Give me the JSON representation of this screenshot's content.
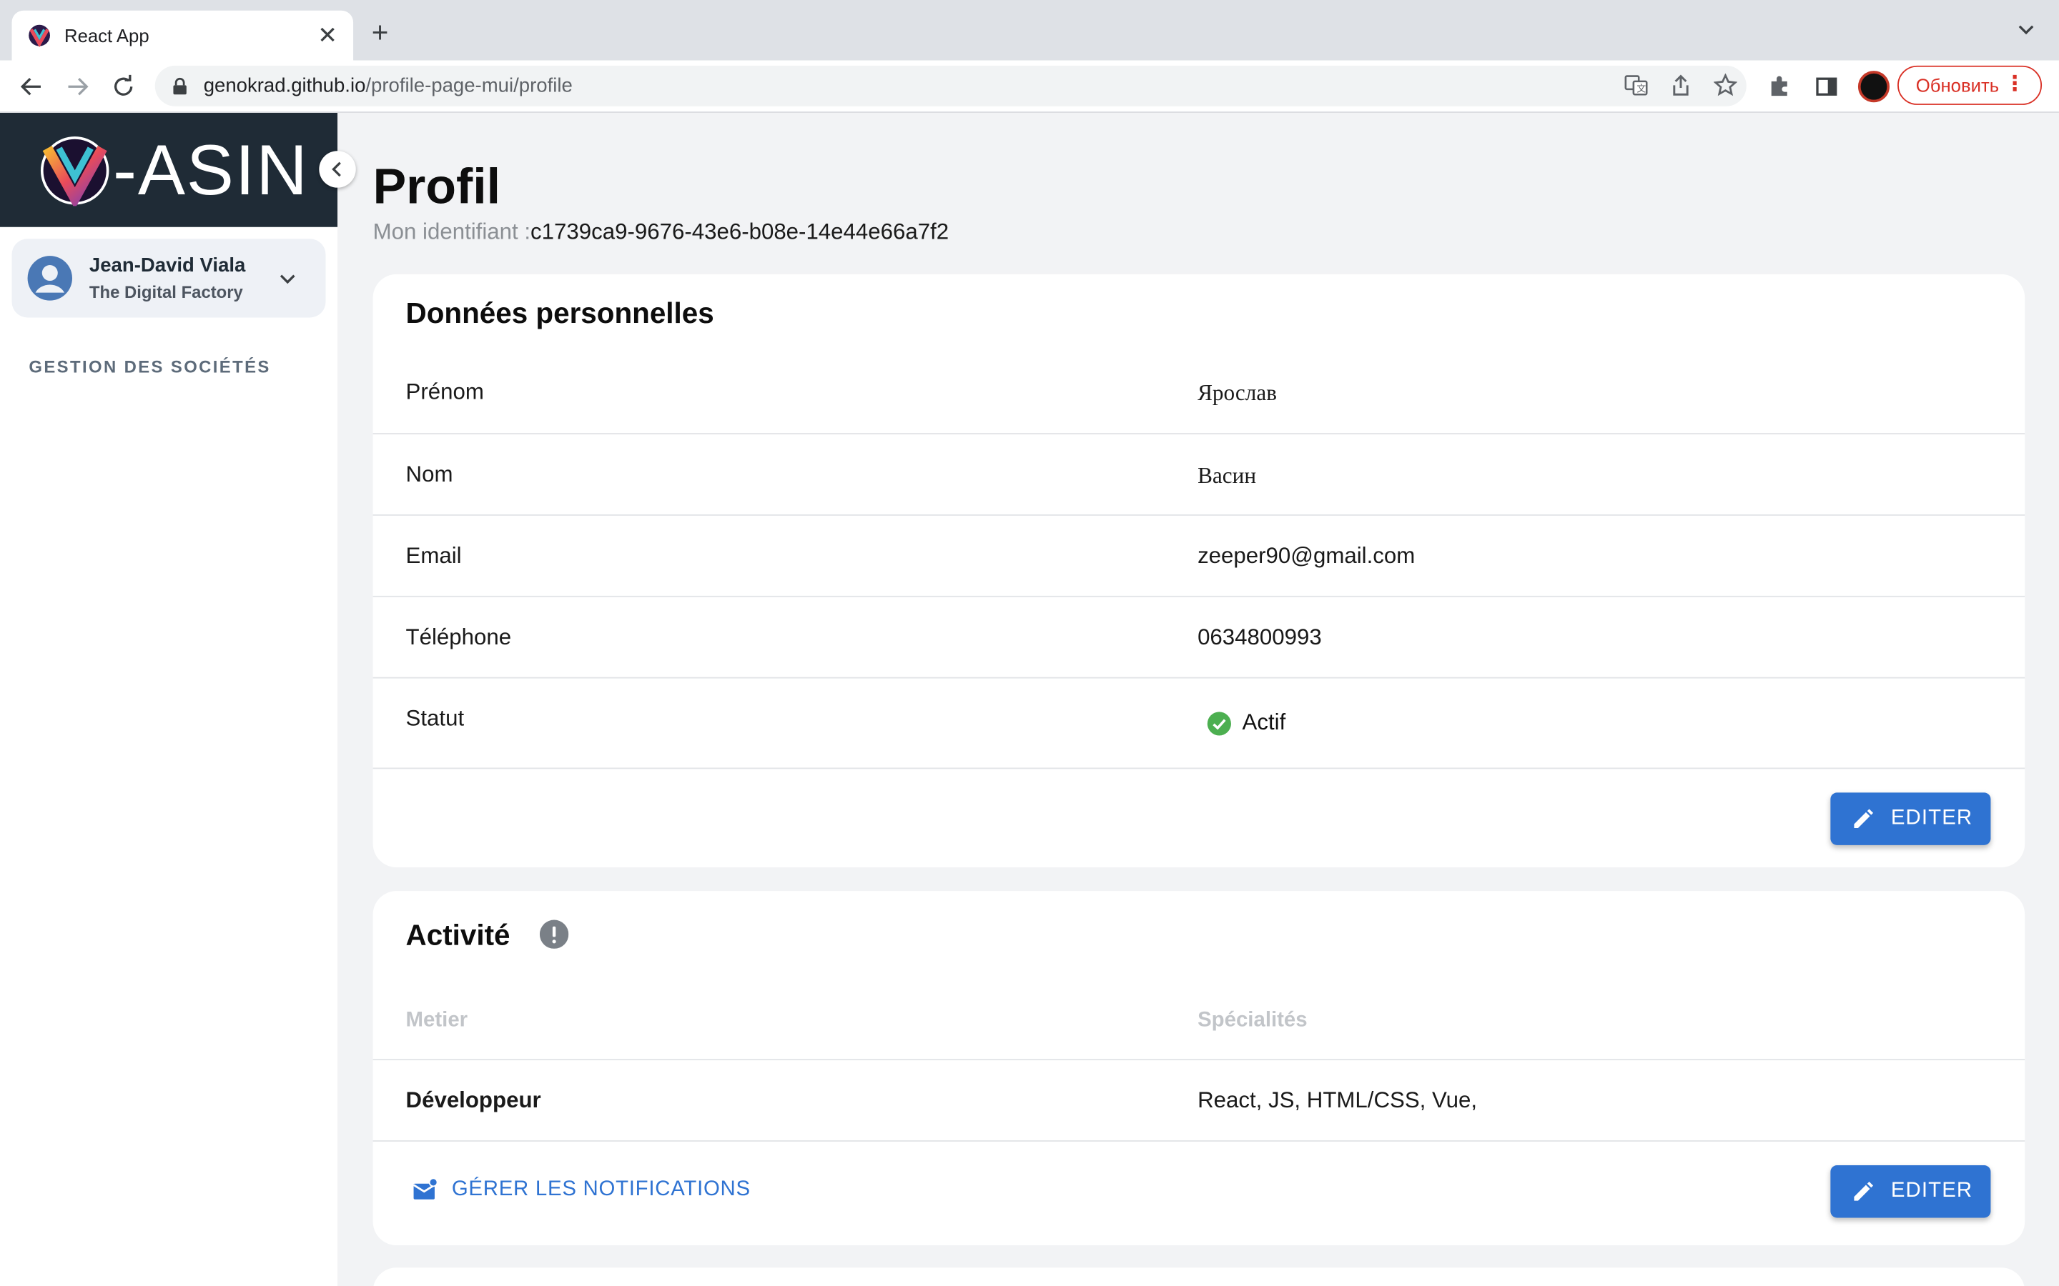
{
  "browser": {
    "tab_title": "React App",
    "url_host": "genokrad.github.io",
    "url_path": "/profile-page-mui/profile",
    "update_label": "Обновить"
  },
  "sidebar": {
    "brand_text": "-ASIN",
    "user": {
      "name": "Jean-David Viala",
      "company": "The Digital Factory"
    },
    "section_label": "GESTION DES SOCIÉTÉS"
  },
  "page": {
    "title": "Profil",
    "identifier_label": "Mon identifiant :",
    "identifier_value": "c1739ca9-9676-43e6-b08e-14e44e66a7f2"
  },
  "personal": {
    "title": "Données personnelles",
    "rows": [
      {
        "label": "Prénom",
        "value": "Ярослав"
      },
      {
        "label": "Nom",
        "value": "Васин"
      },
      {
        "label": "Email",
        "value": "zeeper90@gmail.com"
      },
      {
        "label": "Téléphone",
        "value": "0634800993"
      },
      {
        "label": "Statut",
        "value": "Actif"
      }
    ],
    "edit_label": "EDITER"
  },
  "activity": {
    "title": "Activité",
    "col_metier": "Metier",
    "col_specialites": "Spécialités",
    "metier": "Développeur",
    "specialites": "React, JS, HTML/CSS, Vue,",
    "notif_label": "GÉRER LES NOTIFICATIONS",
    "edit_label": "EDITER"
  },
  "colors": {
    "primary": "#2f73d2",
    "sidebar_brand_bg": "#1f2b36",
    "status_active": "#4caf50",
    "update_red": "#d93025"
  }
}
